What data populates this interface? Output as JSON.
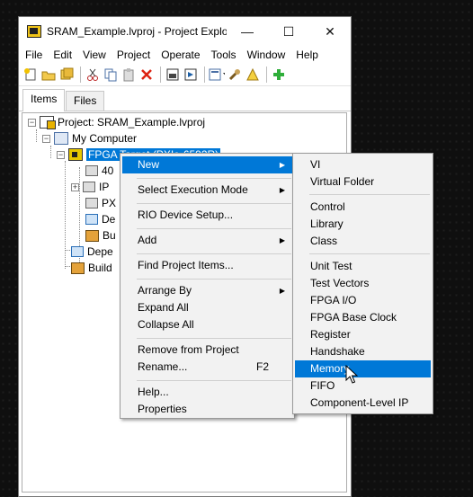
{
  "window": {
    "title": "SRAM_Example.lvproj - Project Explo...",
    "controls": {
      "minimize": "—",
      "maximize": "☐",
      "close": "✕"
    }
  },
  "menubar": [
    "File",
    "Edit",
    "View",
    "Project",
    "Operate",
    "Tools",
    "Window",
    "Help"
  ],
  "toolbar": {
    "icons": [
      "new-icon",
      "open-icon",
      "save-all-icon",
      "cut-icon",
      "copy-icon",
      "paste-icon",
      "delete-icon",
      "build-icon",
      "deploy-icon",
      "view-options-icon",
      "wrench-icon",
      "warning-icon",
      "run-icon"
    ]
  },
  "tabs": {
    "items": "Items",
    "files": "Files"
  },
  "tree": {
    "project": "Project: SRAM_Example.lvproj",
    "my_computer": "My Computer",
    "fpga_target": "FPGA Target (PXIe-6592R)",
    "child1": "40",
    "child2": "IP",
    "child3": "PX",
    "child4": "De",
    "child5": "Bu",
    "dependencies": "Depe",
    "build_specs": "Build"
  },
  "context_menu": {
    "new": "New",
    "select_mode": "Select Execution Mode",
    "rio_setup": "RIO Device Setup...",
    "add": "Add",
    "find_items": "Find Project Items...",
    "arrange_by": "Arrange By",
    "expand_all": "Expand All",
    "collapse_all": "Collapse All",
    "remove": "Remove from Project",
    "rename": "Rename...",
    "rename_shortcut": "F2",
    "help": "Help...",
    "properties": "Properties"
  },
  "submenu": {
    "vi": "VI",
    "virtual_folder": "Virtual Folder",
    "control": "Control",
    "library": "Library",
    "class": "Class",
    "unit_test": "Unit Test",
    "test_vectors": "Test Vectors",
    "fpga_io": "FPGA I/O",
    "fpga_base_clock": "FPGA Base Clock",
    "register": "Register",
    "handshake": "Handshake",
    "memory": "Memory",
    "fifo": "FIFO",
    "component_ip": "Component-Level IP"
  },
  "colors": {
    "highlight": "#0078d7",
    "menu_bg": "#f2f2f2",
    "desktop": "#0f0f0f"
  }
}
